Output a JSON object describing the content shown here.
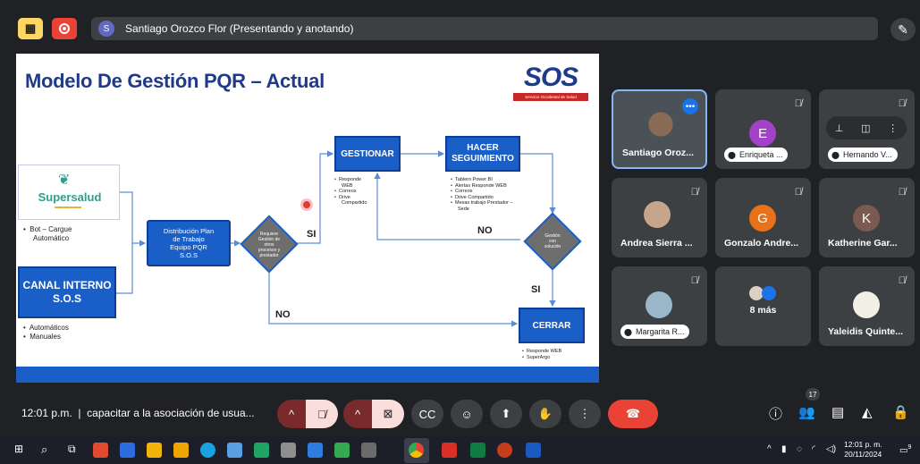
{
  "top_bar": {
    "presenter_avatar_letter": "S",
    "presenter_text": "Santiago Orozco Flor (Presentando y anotando)"
  },
  "slide": {
    "title": "Modelo De Gestión PQR – Actual",
    "logo_text": "SOS",
    "logo_subtitle": "Servicio Occidental de Salud",
    "supersalud_label": "Supersalud",
    "supersalud_bullets": [
      "Bot – Cargue",
      "Automático"
    ],
    "canal_interno": [
      "CANAL INTERNO",
      "S.O.S"
    ],
    "canal_bullets": [
      "Automáticos",
      "Manuales"
    ],
    "distribucion": [
      "Distribución Plan",
      "de Trabajo",
      "Equipo PQR",
      "S.O.S"
    ],
    "diamond1_text": [
      "Requiere",
      "Gestión de",
      "otros",
      "procesos y",
      "prestador"
    ],
    "gestionar_label": "GESTIONAR",
    "gestionar_bullets": [
      "Responde",
      "WEB",
      "Correos",
      "Drive",
      "Compartido"
    ],
    "hacer_label": [
      "HACER",
      "SEGUIMIENTO"
    ],
    "hacer_bullets": [
      "Tablero Power BI",
      "Alertas Responde WEB",
      "Correos",
      "Drive Compartido",
      "Mesas trabajo Prestador –",
      "Sede"
    ],
    "diamond2_text": [
      "Gestión",
      "con",
      "solución"
    ],
    "cerrar_label": "CERRAR",
    "cerrar_bullets": [
      "Responde WEB",
      "SuperArgo"
    ],
    "label_si_1": "SI",
    "label_no_1": "NO",
    "label_si_2": "SI",
    "label_no_2": "NO"
  },
  "participants": [
    {
      "name": "Santiago Oroz...",
      "type": "video",
      "active": true
    },
    {
      "name": "Enriqueta ...",
      "letter": "E",
      "color": "#a142c8",
      "pill": true
    },
    {
      "name": "Hernando V...",
      "pill": true,
      "controls": true
    },
    {
      "name": "Andrea Sierra ...",
      "photo": true
    },
    {
      "name": "Gonzalo Andre...",
      "letter": "G",
      "color": "#e8711a"
    },
    {
      "name": "Katherine Gar...",
      "letter": "K",
      "color": "#7b5a50"
    },
    {
      "name": "Margarita R...",
      "photo": true,
      "pill": true
    },
    {
      "name": "8 más",
      "group": true
    },
    {
      "name": "Yaleidis Quinte...",
      "photo": true
    }
  ],
  "meeting_bar": {
    "time": "12:01 p.m.",
    "separator": "|",
    "meeting_name": "capacitar a la asociación de usua...",
    "participant_count": "17"
  },
  "taskbar": {
    "time": "12:01 p. m.",
    "date": "20/11/2024",
    "notif_count": "9"
  },
  "colors": {
    "meet_bg": "#202124",
    "tile_bg": "#3c4043",
    "end_call": "#ea4335",
    "slide_blue": "#1a5fc7",
    "title_blue": "#1f3a8a"
  }
}
